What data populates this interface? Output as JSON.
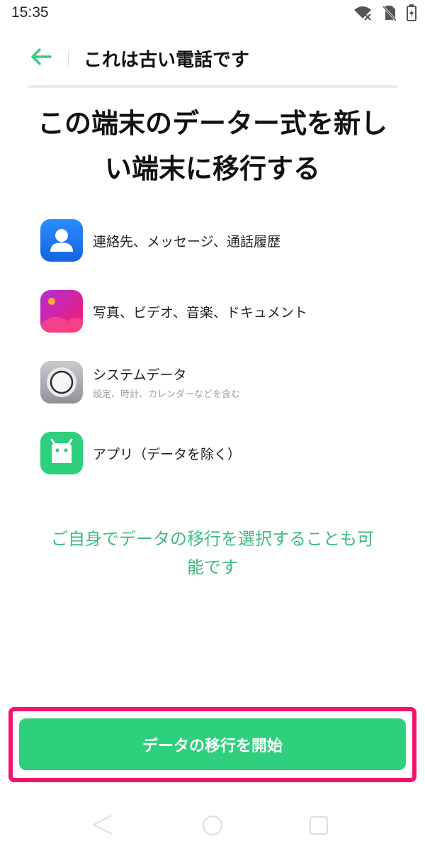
{
  "status_bar": {
    "time": "15:35",
    "icons": [
      "wifi-off-icon",
      "no-sim-icon",
      "battery-charging-icon"
    ]
  },
  "header": {
    "back_icon": "arrow-left-icon",
    "title": "これは古い電話です"
  },
  "headline": {
    "line1": "この端末のデーター式を新し",
    "line2": "い端末に移行する"
  },
  "items": [
    {
      "icon": "contacts-icon",
      "label": "連絡先、メッセージ、通話履歴",
      "sublabel": ""
    },
    {
      "icon": "photos-icon",
      "label": "写真、ビデオ、音楽、ドキュメント",
      "sublabel": ""
    },
    {
      "icon": "settings-icon",
      "label": "システムデータ",
      "sublabel": "設定、時計、カレンダーなどを含む"
    },
    {
      "icon": "android-app-icon",
      "label": "アプリ（データを除く）",
      "sublabel": ""
    }
  ],
  "note": {
    "line1": "ご自身でデータの移行を選択することも可",
    "line2": "能です"
  },
  "start_button": {
    "label": "データの移行を開始"
  },
  "colors": {
    "accent_green": "#2ecf7d",
    "note_green": "#3dbd7d",
    "highlight_pink": "#f0156a",
    "contacts_blue": "#1f7bf2"
  }
}
